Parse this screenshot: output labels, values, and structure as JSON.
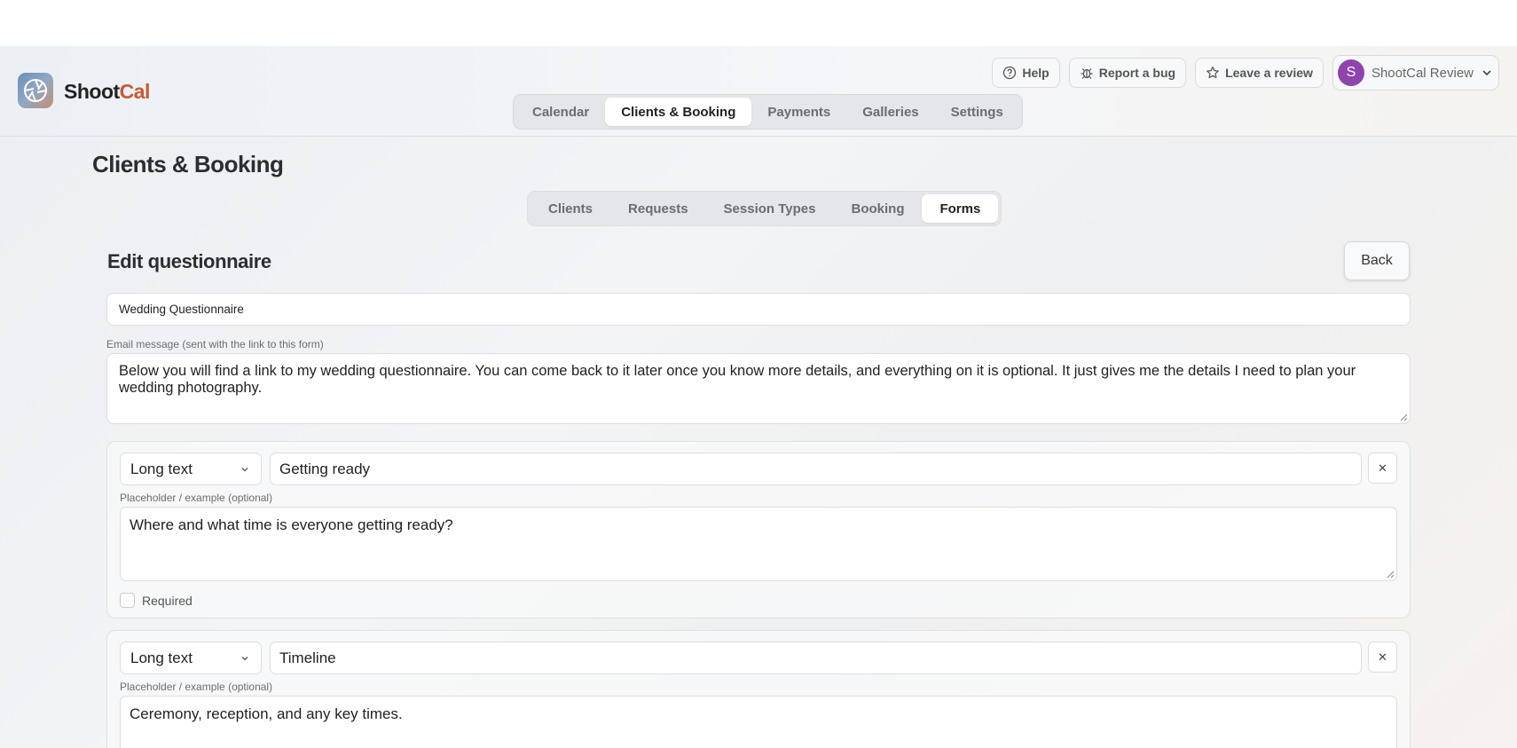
{
  "brand": {
    "name_a": "Shoot",
    "name_b": "Cal",
    "accent_color": "#c75a33"
  },
  "top_actions": {
    "help": "Help",
    "report_bug": "Report a bug",
    "review": "Leave a review",
    "account_initial": "S",
    "account_name": "ShootCal Review"
  },
  "main_nav": [
    "Calendar",
    "Clients & Booking",
    "Payments",
    "Galleries",
    "Settings"
  ],
  "main_nav_active": "Clients & Booking",
  "page_title": "Clients & Booking",
  "sub_nav": [
    "Clients",
    "Requests",
    "Session Types",
    "Booking",
    "Forms"
  ],
  "sub_nav_active": "Forms",
  "editor": {
    "title": "Edit questionnaire",
    "back_label": "Back",
    "form_name": "Wedding Questionnaire",
    "email_label": "Email message (sent with the link to this form)",
    "email_message": "Below you will find a link to my wedding questionnaire. You can come back to it later once you know more details, and everything on it is optional. It just gives me the details I need to plan your wedding photography."
  },
  "questions": [
    {
      "type": "Long text",
      "question": "Getting ready",
      "placeholder_label": "Placeholder / example (optional)",
      "placeholder": "Where and what time is everyone getting ready?",
      "required_label": "Required",
      "required": false
    },
    {
      "type": "Long text",
      "question": "Timeline",
      "placeholder_label": "Placeholder / example (optional)",
      "placeholder": "Ceremony, reception, and any key times."
    }
  ]
}
